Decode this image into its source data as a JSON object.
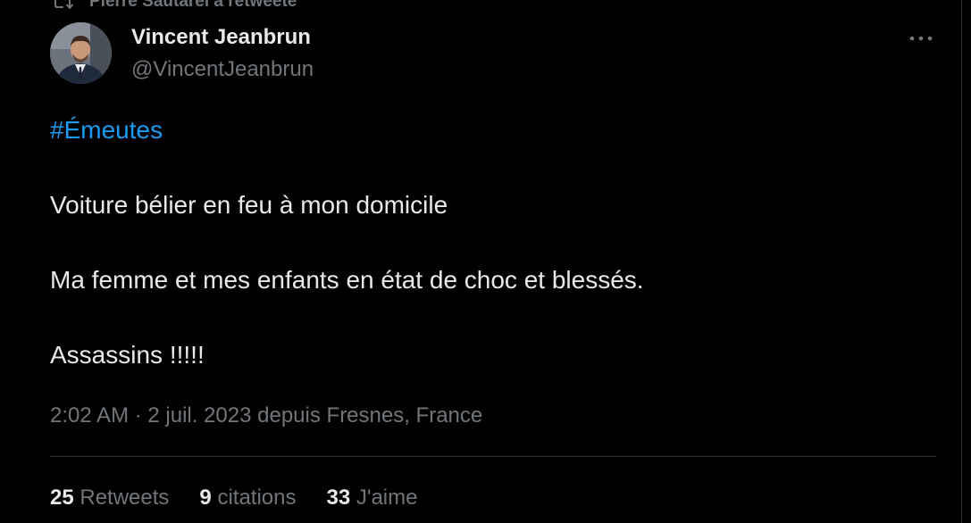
{
  "retweet_context": {
    "text": "Pierre Sautarel a retweeté",
    "icon": "retweet-icon"
  },
  "author": {
    "display_name": "Vincent Jeanbrun",
    "handle": "@VincentJeanbrun",
    "avatar": "profile-photo"
  },
  "more_icon": "more-options-icon",
  "tweet": {
    "hashtag": "#Émeutes",
    "lines": [
      "Voiture bélier en feu à mon domicile",
      "Ma femme et mes enfants en état de choc et blessés.",
      "Assassins !!!!!"
    ],
    "meta": "2:02 AM · 2 juil. 2023 depuis Fresnes, France"
  },
  "stats": {
    "retweets": {
      "count": "25",
      "label": "Retweets"
    },
    "quotes": {
      "count": "9",
      "label": "citations"
    },
    "likes": {
      "count": "33",
      "label": "J'aime"
    }
  },
  "colors": {
    "background": "#000000",
    "text": "#e7e9ea",
    "secondary": "#71767b",
    "link": "#1d9bf0",
    "divider": "#2f3336"
  }
}
